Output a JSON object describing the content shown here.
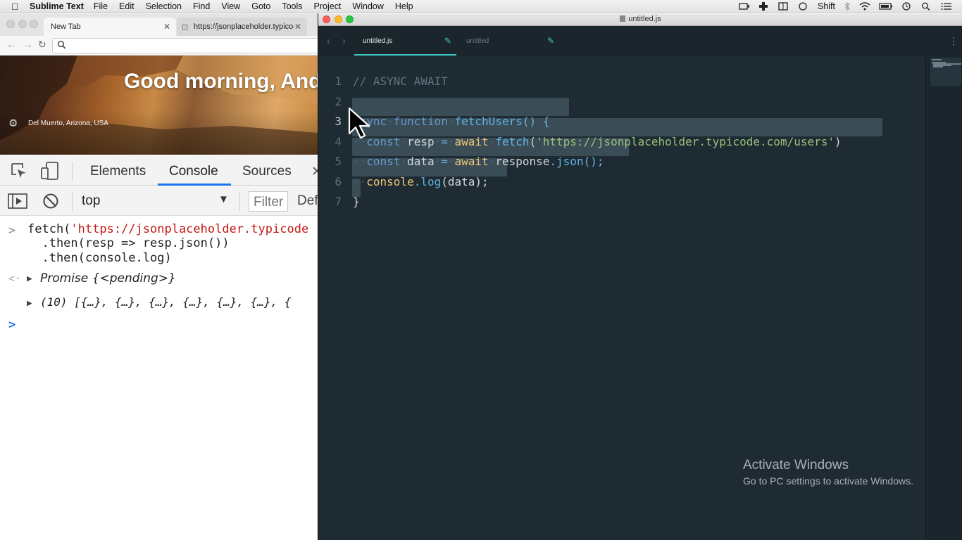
{
  "menubar": {
    "app_name": "Sublime Text",
    "items": [
      "File",
      "Edit",
      "Selection",
      "Find",
      "View",
      "Goto",
      "Tools",
      "Project",
      "Window",
      "Help"
    ],
    "status_text": "Shift"
  },
  "chrome": {
    "tabs": [
      {
        "label": "New Tab",
        "active": true
      },
      {
        "label": "https://jsonplaceholder.typicode.com",
        "active": false
      }
    ],
    "omnibox_value": "",
    "greeting": "Good morning, And",
    "location": "Del Muerto, Arizona, USA",
    "devtools": {
      "tabs": [
        "Elements",
        "Console",
        "Sources"
      ],
      "selected_tab": "Console",
      "context": "top",
      "filter_placeholder": "Filter",
      "levels": "Def",
      "console_lines": [
        {
          "prefix": "fetch(",
          "string": "'https://jsonplaceholder.typicode",
          "rest": ""
        },
        {
          "text": "  .then(resp => resp.json())"
        },
        {
          "text": "  .then(console.log)"
        },
        {
          "text": "Promise {<pending>}"
        },
        {
          "text": "(10) [{…}, {…}, {…}, {…}, {…}, {…}, {"
        }
      ]
    }
  },
  "sublime": {
    "window_title": "untitled.js",
    "tabs": [
      {
        "label": "untitled.js",
        "active": true
      },
      {
        "label": "untitled",
        "active": false
      }
    ],
    "line_numbers": [
      "1",
      "2",
      "3",
      "4",
      "5",
      "6",
      "7"
    ],
    "code": {
      "l1": "// ASYNC AWAIT",
      "l3_kw": "async",
      "l3_fn_kw": "function",
      "l3_name": "fetchUsers",
      "l3_rest": "() {",
      "l4_const": "const",
      "l4_var": "resp",
      "l4_eq": "=",
      "l4_await": "await",
      "l4_fetch": "fetch",
      "l4_open": "(",
      "l4_str": "'https://jsonplaceholder.typicode.com/users'",
      "l4_close": ")",
      "l5_const": "const",
      "l5_var": "data",
      "l5_eq": "=",
      "l5_await": "await",
      "l5_obj": "response",
      "l5_method": ".json();",
      "l6_console": "console",
      "l6_log": ".log",
      "l6_args": "(data);",
      "l7": "}"
    }
  },
  "watermark": {
    "title": "Activate Windows",
    "subtitle": "Go to PC settings to activate Windows."
  },
  "colors": {
    "sublime_bg": "#1f2b33",
    "accent_teal": "#3ec7c1",
    "devtools_blue": "#1a73e8"
  }
}
